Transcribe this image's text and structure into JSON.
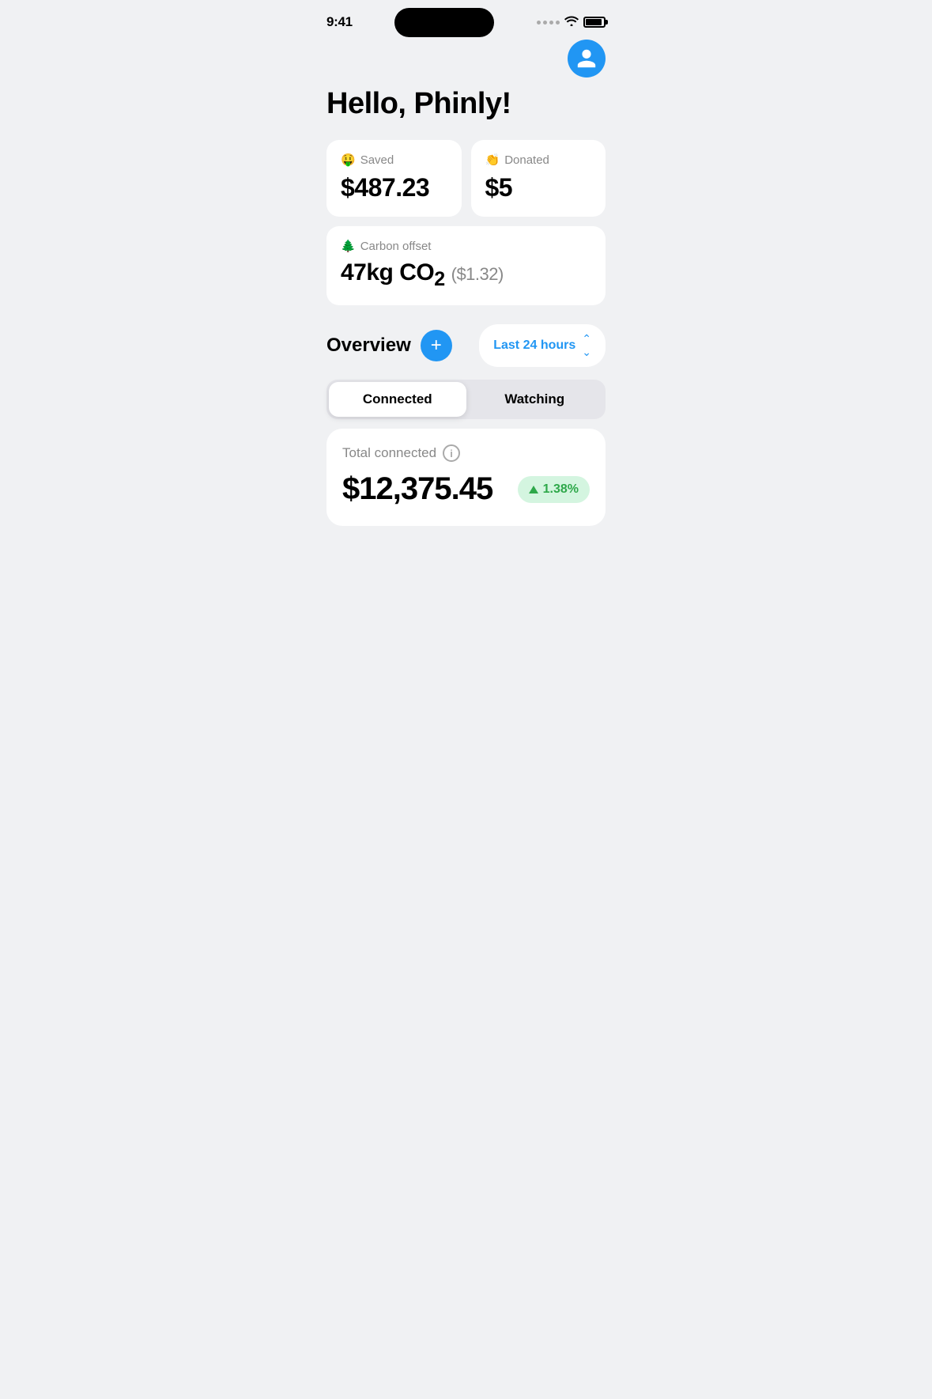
{
  "statusBar": {
    "time": "9:41"
  },
  "header": {
    "greeting": "Hello, Phinly!"
  },
  "stats": {
    "savedLabel": "Saved",
    "savedEmoji": "🤑",
    "savedValue": "$487.23",
    "donatedLabel": "Donated",
    "donatedEmoji": "👏",
    "donatedValue": "$5",
    "carbonLabel": "Carbon offset",
    "carbonEmoji": "🌲",
    "carbonValue": "47kg CO",
    "carbonSub": "2",
    "carbonPrice": "($1.32)"
  },
  "overview": {
    "title": "Overview",
    "addLabel": "+",
    "timeFilter": "Last 24 hours"
  },
  "tabs": {
    "connected": "Connected",
    "watching": "Watching"
  },
  "totalCard": {
    "label": "Total connected",
    "value": "$12,375.45",
    "change": "1.38%"
  }
}
